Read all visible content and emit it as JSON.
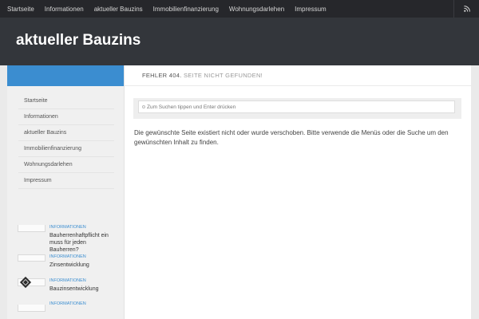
{
  "topnav": {
    "items": [
      "Startseite",
      "Informationen",
      "aktueller Bauzins",
      "Immobilienfinanzierung",
      "Wohnungsdarlehen",
      "Impressum"
    ],
    "rss_icon": "rss-icon"
  },
  "header": {
    "site_title": "aktueller Bauzins"
  },
  "sidebar": {
    "menu": [
      "Startseite",
      "Informationen",
      "aktueller Bauzins",
      "Immobilienfinanzierung",
      "Wohnungsdarlehen",
      "Impressum"
    ],
    "posts": [
      {
        "category": "INFORMATIONEN",
        "title": "Bauherrenhaftpflicht ein muss für jeden Bauherren?"
      },
      {
        "category": "INFORMATIONEN",
        "title": "Zinsentwicklung"
      },
      {
        "category": "INFORMATIONEN",
        "title": "Bauzinsentwicklung"
      },
      {
        "category": "INFORMATIONEN",
        "title": ""
      }
    ]
  },
  "main": {
    "error_code": "FEHLER 404.",
    "error_message": "SEITE NICHT GEFUNDEN!",
    "search_placeholder": "Zum Suchen tippen und Enter drücken",
    "notfound_text": "Die gewünschte Seite existiert nicht oder wurde verschoben. Bitte verwende die Menüs oder die Suche um den gewünschten Inhalt zu finden."
  },
  "colors": {
    "accent": "#3b8dd0",
    "topbar": "#26272b",
    "header": "#33363b"
  }
}
